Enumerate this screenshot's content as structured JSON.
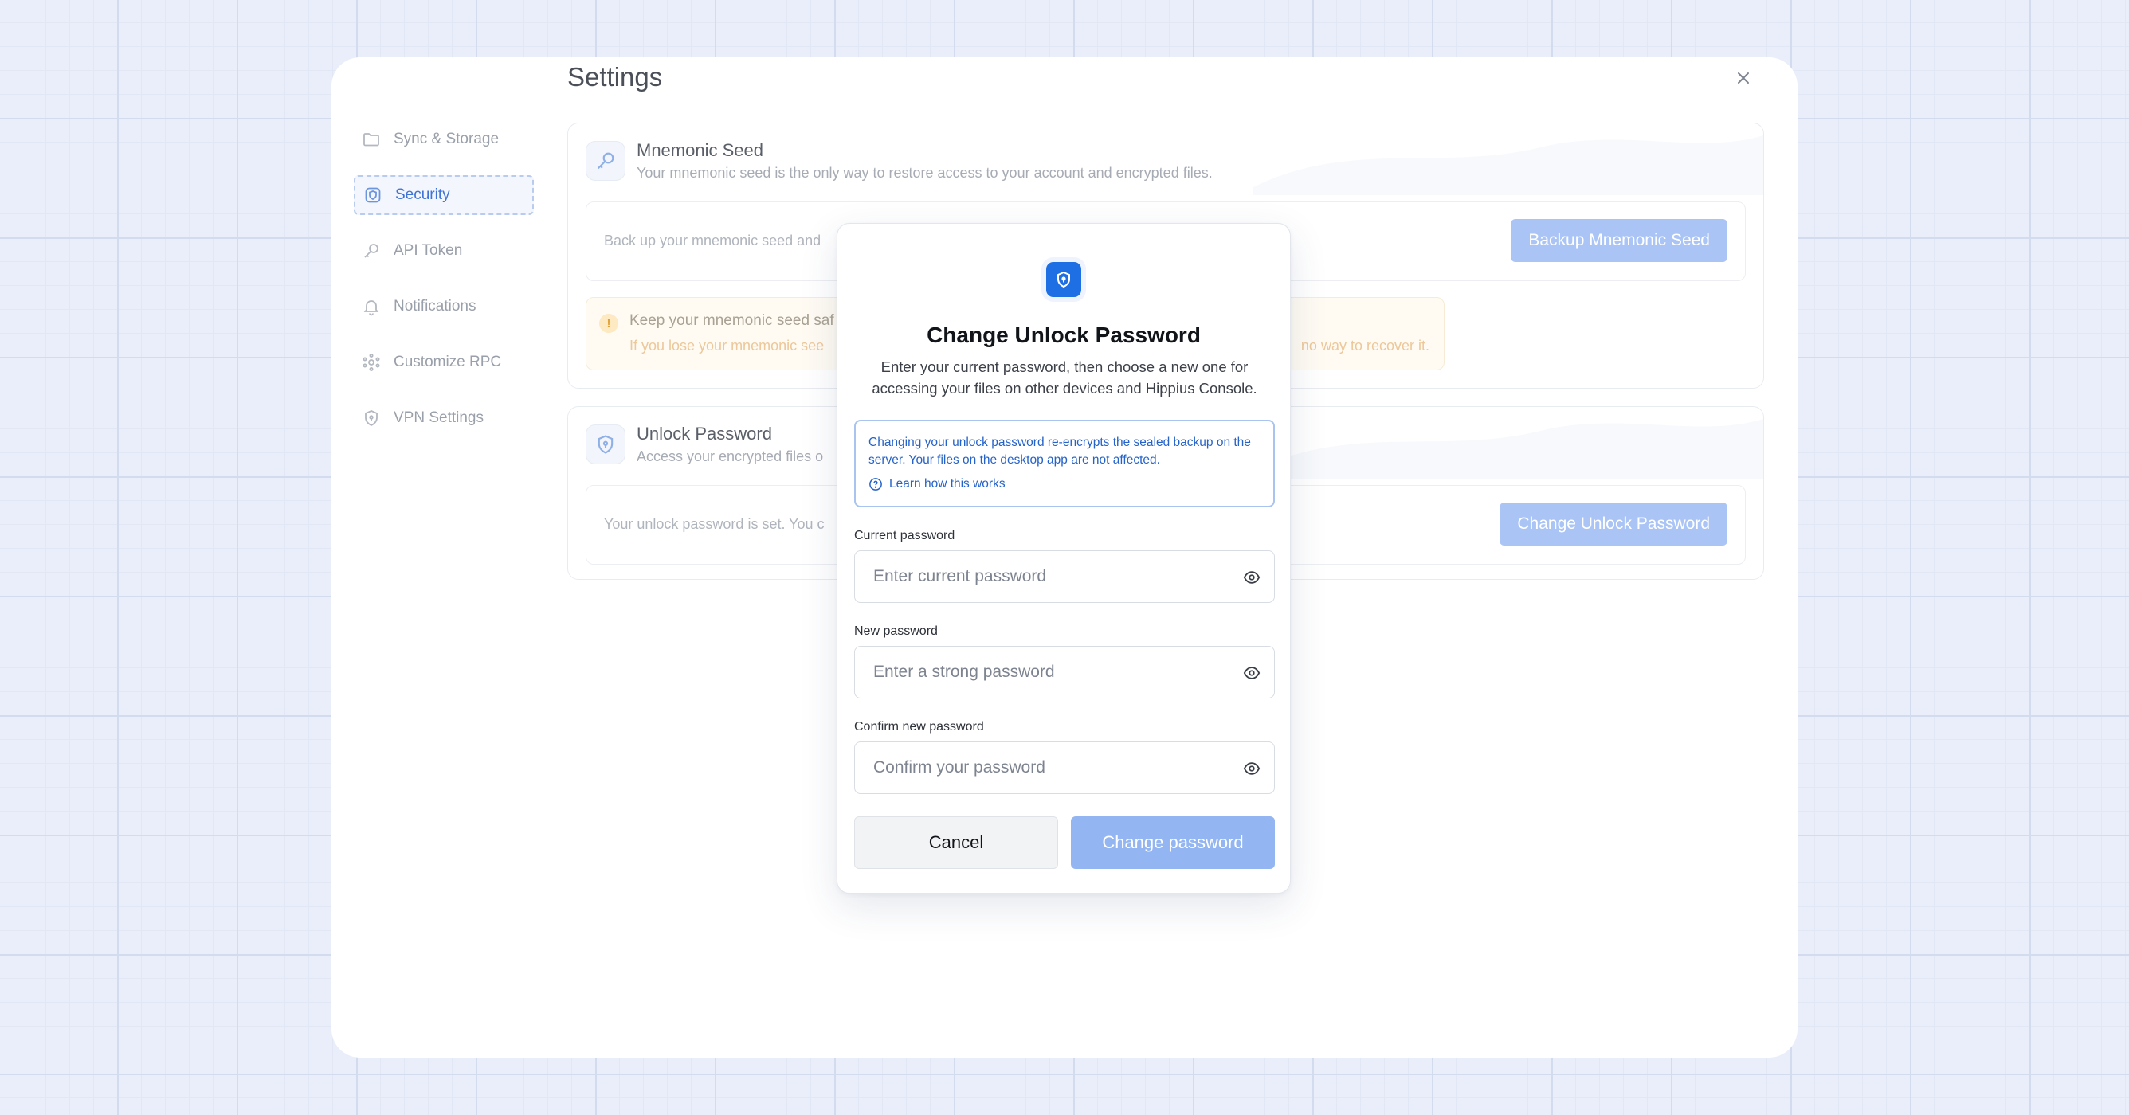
{
  "settings": {
    "title": "Settings",
    "close_label": "×"
  },
  "sidebar": {
    "items": [
      {
        "label": "Sync & Storage",
        "icon": "folder-icon"
      },
      {
        "label": "Security",
        "icon": "shield-icon",
        "active": true
      },
      {
        "label": "API Token",
        "icon": "key-icon"
      },
      {
        "label": "Notifications",
        "icon": "bell-icon"
      },
      {
        "label": "Customize RPC",
        "icon": "network-icon"
      },
      {
        "label": "VPN Settings",
        "icon": "shield-lock-icon"
      }
    ]
  },
  "mnemonic": {
    "title": "Mnemonic Seed",
    "subtitle": "Your mnemonic seed is the only way to restore access to your account and encrypted files.",
    "inner_text": "Back up your mnemonic seed and",
    "button_label": "Backup Mnemonic Seed",
    "warning_title": "Keep your mnemonic seed saf",
    "warning_body": "If you lose your mnemonic see",
    "warning_tail": "no way to recover it."
  },
  "unlock": {
    "title": "Unlock Password",
    "subtitle": "Access your encrypted files o",
    "inner_text": "Your unlock password is set. You c",
    "button_label": "Change Unlock Password"
  },
  "modal": {
    "title": "Change Unlock Password",
    "description": "Enter your current password, then choose a new one for accessing your files on other devices and Hippius Console.",
    "info_text": "Changing your unlock password re-encrypts the sealed backup on the server. Your files on the desktop app are not affected.",
    "info_link": "Learn how this works",
    "fields": [
      {
        "label": "Current password",
        "placeholder": "Enter current password",
        "value": ""
      },
      {
        "label": "New password",
        "placeholder": "Enter a strong password",
        "value": ""
      },
      {
        "label": "Confirm new password",
        "placeholder": "Confirm your password",
        "value": ""
      }
    ],
    "cancel_label": "Cancel",
    "submit_label": "Change password"
  },
  "colors": {
    "accent": "#1f6fe4",
    "primary_disabled": "#93b6f2",
    "info_text": "#2563c9",
    "warning": "#ecc89a"
  }
}
